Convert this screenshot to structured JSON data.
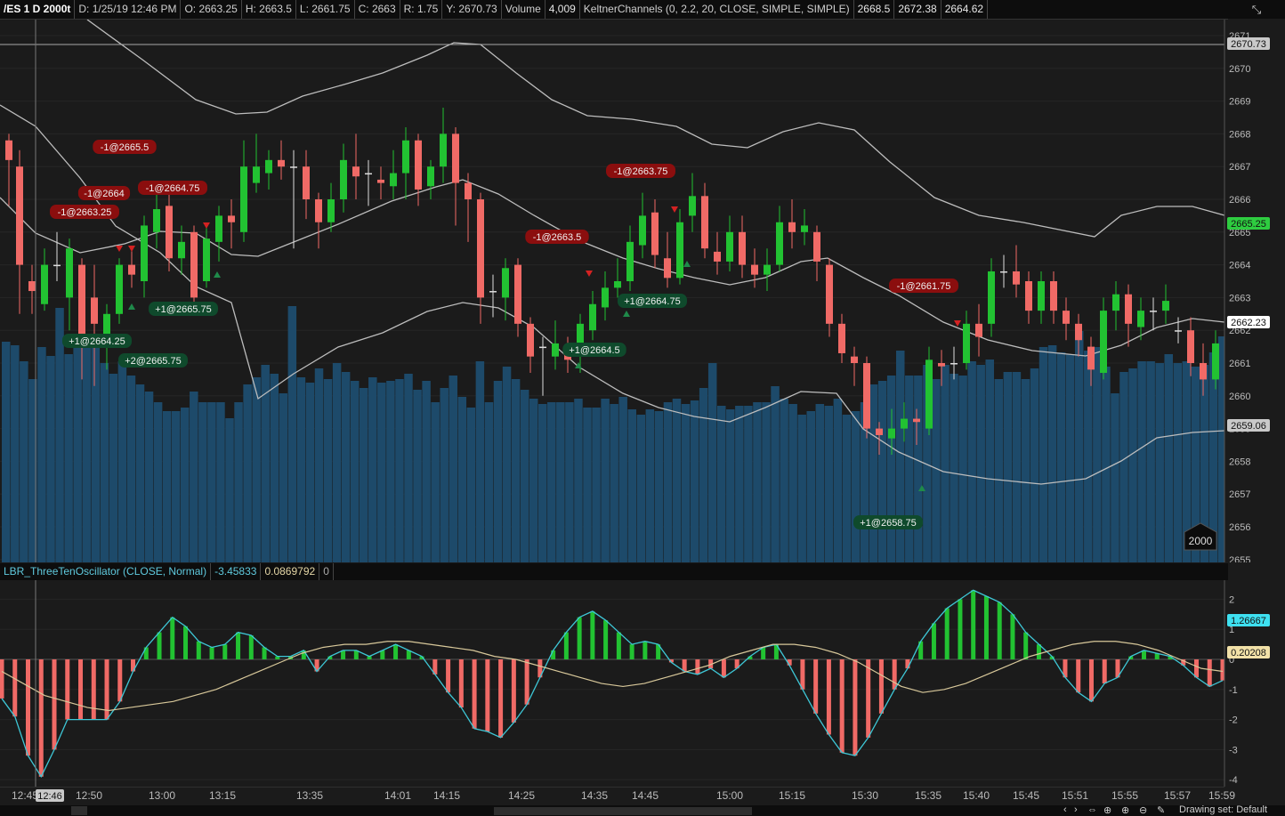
{
  "header": {
    "symbol": "/ES 1 D 2000t",
    "date": "D: 1/25/19 12:46 PM",
    "open": "O: 2663.25",
    "high": "H: 2663.5",
    "low": "L: 2661.75",
    "close": "C: 2663",
    "range": "R: 1.75",
    "y": "Y: 2670.73",
    "volume_label": "Volume",
    "volume_value": "4,009",
    "study": "KeltnerChannels (0, 2.2, 20, CLOSE, SIMPLE, SIMPLE)",
    "study_v1": "2668.5",
    "study_v2": "2672.38",
    "study_v3": "2664.62",
    "collapse_icon": "collapse-arrows-icon"
  },
  "oscillator_header": {
    "name": "LBR_ThreeTenOscillator (CLOSE, Normal)",
    "v1": "-3.45833",
    "v2": "0.0869792",
    "v3": "0"
  },
  "colors": {
    "up": "#22c232",
    "down": "#f06a66",
    "volume": "#1d4a6a",
    "band": "#bdbdbd",
    "sell_bubble": "#8b0e0e",
    "buy_bubble": "#0f4a2c",
    "osc_line": "#3ec7d6",
    "osc_signal": "#d8c89a"
  },
  "price_axis": {
    "ticks": [
      "2671",
      "2670",
      "2669",
      "2668",
      "2667",
      "2666",
      "2665",
      "2664",
      "2663",
      "2662",
      "2661",
      "2660",
      "2659",
      "2658",
      "2657",
      "2656",
      "2655"
    ],
    "cursor_label": "2670.73",
    "last_price_label": "2665.25",
    "mid_band_label": "2662.23",
    "lower_band_label": "2659.06",
    "tick_count_badge": "2000"
  },
  "osc_axis": {
    "ticks": [
      "2",
      "1",
      "0",
      "-1",
      "-2",
      "-3",
      "-4"
    ],
    "value_label": "1.26667",
    "signal_label": "0.20208"
  },
  "time_axis": {
    "cursor_label": "12:46",
    "labels": [
      "12:45",
      "12:50",
      "13:00",
      "13:15",
      "13:35",
      "14:01",
      "14:15",
      "14:25",
      "14:35",
      "14:45",
      "15:00",
      "15:15",
      "15:30",
      "15:35",
      "15:40",
      "15:45",
      "15:51",
      "15:55",
      "15:57",
      "15:59"
    ]
  },
  "trades": [
    {
      "label": "-1@2665.5",
      "side": "sell"
    },
    {
      "label": "-1@2664",
      "side": "sell"
    },
    {
      "label": "-1@2663.25",
      "side": "sell"
    },
    {
      "label": "-1@2664.75",
      "side": "sell"
    },
    {
      "label": "+1@2665.75",
      "side": "buy"
    },
    {
      "label": "+1@2664.25",
      "side": "buy"
    },
    {
      "label": "+2@2665.75",
      "side": "buy"
    },
    {
      "label": "-1@2663.75",
      "side": "sell"
    },
    {
      "label": "-1@2663.5",
      "side": "sell"
    },
    {
      "label": "+1@2664.75",
      "side": "buy"
    },
    {
      "label": "+1@2664.5",
      "side": "buy"
    },
    {
      "label": "-1@2661.75",
      "side": "sell"
    },
    {
      "label": "+1@2658.75",
      "side": "buy"
    }
  ],
  "bottom_bar": {
    "drawing_set": "Drawing set: Default",
    "tool_icons": [
      "pan-icon",
      "crosshair-icon",
      "zoom-in-icon",
      "zoom-out-icon",
      "pencil-icon"
    ]
  }
}
